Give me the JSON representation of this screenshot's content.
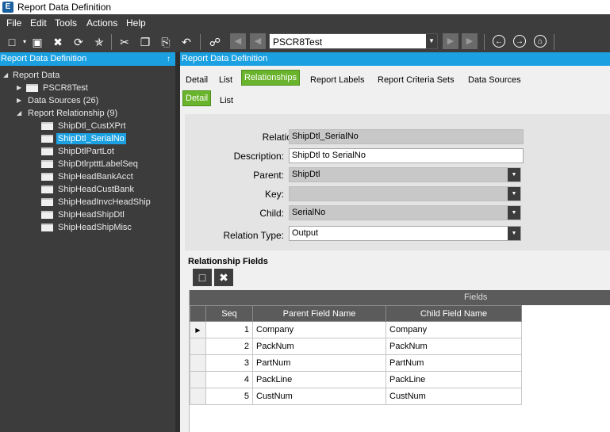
{
  "window": {
    "title": "Report Data Definition",
    "logo": "E"
  },
  "menu": [
    "File",
    "Edit",
    "Tools",
    "Actions",
    "Help"
  ],
  "toolbar": {
    "search_value": "PSCR8Test"
  },
  "left_panel": {
    "header": "Report Data Definition",
    "tree": {
      "root": "Report Data",
      "report": "PSCR8Test",
      "data_sources": "Data Sources (26)",
      "relationships": "Report Relationship (9)",
      "items": [
        "ShipDtl_CustXPrt",
        "ShipDtl_SerialNo",
        "ShipDtlPartLot",
        "ShipDtlrptttLabelSeq",
        "ShipHeadBankAcct",
        "ShipHeadCustBank",
        "ShipHeadInvcHeadShip",
        "ShipHeadShipDtl",
        "ShipHeadShipMisc"
      ],
      "selected_index": 1
    }
  },
  "right_panel": {
    "header": "Report Data Definition",
    "tabs": [
      "Detail",
      "List",
      "Relationships",
      "Report Labels",
      "Report Criteria Sets",
      "Data Sources"
    ],
    "active_tab": "Relationships",
    "subtabs": [
      "Detail",
      "List"
    ],
    "active_subtab": "Detail"
  },
  "form": {
    "relation_label": "Relation:",
    "relation_value": "ShipDtl_SerialNo",
    "description_label": "Description:",
    "description_value": "ShipDtl to SerialNo",
    "parent_label": "Parent:",
    "parent_value": "ShipDtl",
    "key_label": "Key:",
    "key_value": "",
    "child_label": "Child:",
    "child_value": "SerialNo",
    "relation_type_label": "Relation Type:",
    "relation_type_value": "Output"
  },
  "grid": {
    "title": "Relationship Fields",
    "band": "Fields",
    "columns": [
      "Seq",
      "Parent Field Name",
      "Child Field Name"
    ],
    "rows": [
      [
        "1",
        "Company",
        "Company"
      ],
      [
        "2",
        "PackNum",
        "PackNum"
      ],
      [
        "3",
        "PartNum",
        "PartNum"
      ],
      [
        "4",
        "PackLine",
        "PackLine"
      ],
      [
        "5",
        "CustNum",
        "CustNum"
      ]
    ]
  }
}
